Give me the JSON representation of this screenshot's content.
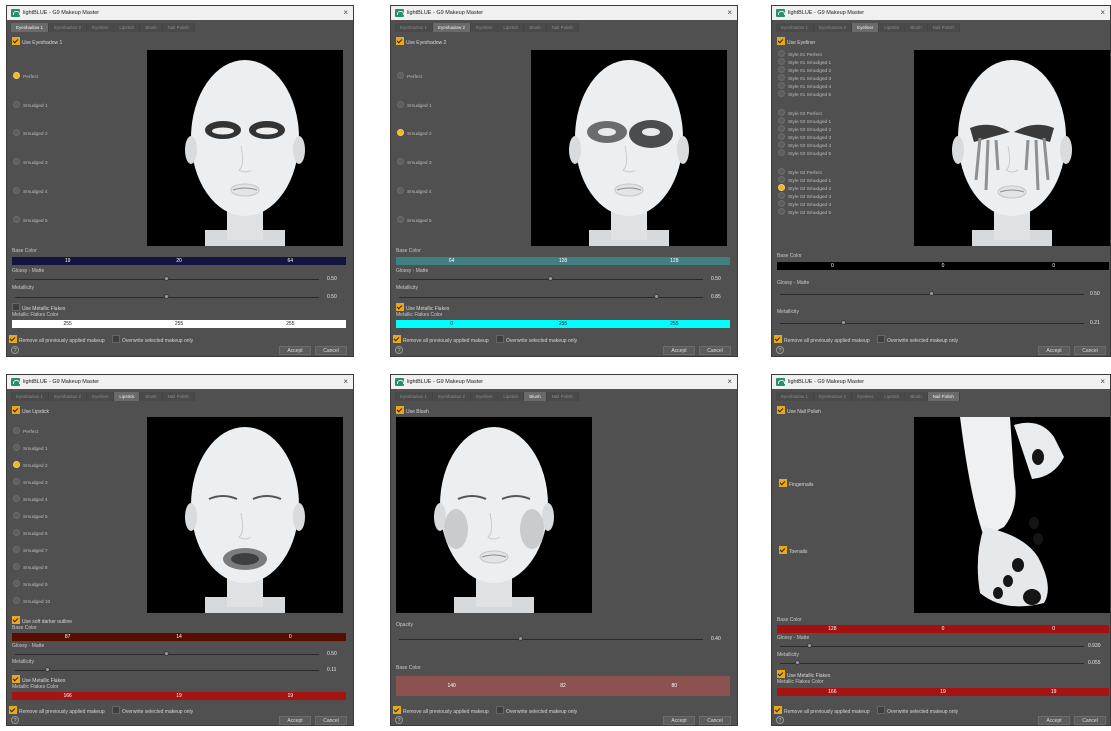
{
  "app_title": "lightBLUE - G9 Makeup Master",
  "close_glyph": "×",
  "tabs": [
    "Eyeshadow 1",
    "Eyeshadow 2",
    "Eyeliner",
    "Lipstick",
    "Blush",
    "Nail Polish"
  ],
  "labels": {
    "base_color": "Base Color",
    "glossy_matte": "Glossy - Matte",
    "metallicity": "Metallicity",
    "use_metallic_flakes": "Use Metallic Flakes",
    "metallic_flakes_color": "Metallic Flakes Color",
    "opacity": "Opacity",
    "remove_prev": "Remove all previously applied makeup",
    "overwrite_selected": "Overwrite selected makeup only",
    "accept": "Accept",
    "cancel": "Cancel",
    "help": "?"
  },
  "colors": {
    "accent_check": "#e8a818",
    "window_bg": "#505050",
    "preview_bg": "#000000"
  },
  "windows": [
    {
      "active_tab": 0,
      "use_label": "Use Eyeshadow 1",
      "options": [
        "Perfect",
        "Smudged 1",
        "Smudged 2",
        "Smudged 3",
        "Smudged 4",
        "Smudged 5"
      ],
      "selected": 0,
      "base_color": {
        "rgb": [
          "19",
          "20",
          "64"
        ],
        "hex": "#131440"
      },
      "glossy": {
        "value": "0.50",
        "fraction": 0.5
      },
      "metallicity": {
        "value": "0.50",
        "fraction": 0.5
      },
      "use_metallic_flakes": false,
      "flakes_color": {
        "rgb": [
          "255",
          "255",
          "255"
        ],
        "hex": "#ffffff"
      }
    },
    {
      "active_tab": 1,
      "use_label": "Use Eyeshadow 2",
      "options": [
        "Perfect",
        "Smudged 1",
        "Smudged 2",
        "Smudged 3",
        "Smudged 4",
        "Smudged 5"
      ],
      "selected": 2,
      "base_color": {
        "rgb": [
          "64",
          "128",
          "128"
        ],
        "hex": "#408080"
      },
      "glossy": {
        "value": "0.50",
        "fraction": 0.5
      },
      "metallicity": {
        "value": "0.85",
        "fraction": 0.85
      },
      "use_metallic_flakes": true,
      "flakes_color": {
        "rgb": [
          "0",
          "255",
          "255"
        ],
        "hex": "#00ffff"
      }
    },
    {
      "active_tab": 2,
      "use_label": "Use Eyeliner",
      "groups": [
        [
          "Style 01 Perfect",
          "Style 01 Smudged 1",
          "Style 01 Smudged 2",
          "Style 01 Smudged 3",
          "Style 01 Smudged 4",
          "Style 01 Smudged 5"
        ],
        [
          "Style 02 Perfect",
          "Style 02 Smudged 1",
          "Style 02 Smudged 2",
          "Style 02 Smudged 3",
          "Style 02 Smudged 4",
          "Style 02 Smudged 5"
        ],
        [
          "Style 03 Perfect",
          "Style 03 Smudged 1",
          "Style 03 Smudged 2",
          "Style 03 Smudged 3",
          "Style 03 Smudged 4",
          "Style 03 Smudged 5"
        ]
      ],
      "selected": "Style 03 Smudged 2",
      "base_color": {
        "rgb": [
          "0",
          "0",
          "0"
        ],
        "hex": "#000000"
      },
      "glossy": {
        "value": "0.50",
        "fraction": 0.5
      },
      "metallicity": {
        "value": "0.21",
        "fraction": 0.21
      }
    },
    {
      "active_tab": 3,
      "use_label": "Use Lipstick",
      "options": [
        "Perfect",
        "Smudged 1",
        "Smudged 2",
        "Smudged 3",
        "Smudged 4",
        "Smudged 5",
        "Smudged 6",
        "Smudged 7",
        "Smudged 8",
        "Smudged 9",
        "Smudged 10"
      ],
      "selected": 2,
      "soft_outline_label": "Use soft darker outline",
      "base_color": {
        "rgb": [
          "87",
          "14",
          "0"
        ],
        "hex": "#570e00"
      },
      "glossy": {
        "value": "0.50",
        "fraction": 0.5
      },
      "metallicity": {
        "value": "0.11",
        "fraction": 0.11
      },
      "use_metallic_flakes": true,
      "flakes_color": {
        "rgb": [
          "166",
          "19",
          "19"
        ],
        "hex": "#a61313"
      }
    },
    {
      "active_tab": 4,
      "use_label": "Use Blush",
      "opacity": {
        "value": "0.40",
        "fraction": 0.4
      },
      "base_color": {
        "rgb": [
          "140",
          "82",
          "80"
        ],
        "hex": "#8c5250"
      }
    },
    {
      "active_tab": 5,
      "use_label": "Use Nail Polish",
      "fingernails_label": "Fingernails",
      "toenails_label": "Toenails",
      "base_color": {
        "rgb": [
          "128",
          "0",
          "0"
        ],
        "hex": "#800000"
      },
      "glossy": {
        "value": "0.930",
        "fraction": 0.1
      },
      "metallicity": {
        "value": "0.055",
        "fraction": 0.055
      },
      "use_metallic_flakes": true,
      "flakes_color": {
        "rgb": [
          "166",
          "19",
          "19"
        ],
        "hex": "#a61313"
      }
    }
  ]
}
